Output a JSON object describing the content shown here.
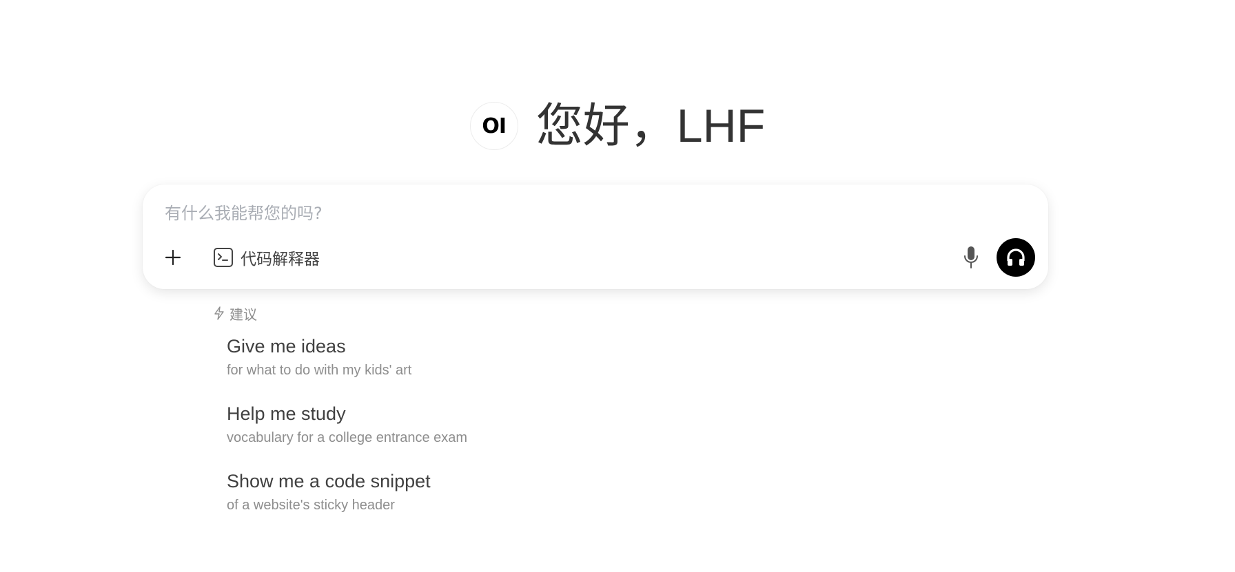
{
  "greeting": {
    "logo_text": "OI",
    "title": "您好，LHF"
  },
  "chat": {
    "placeholder": "有什么我能帮您的吗?",
    "tool_label": "代码解释器"
  },
  "icons": {
    "add": "plus-icon",
    "tool": "terminal-icon",
    "mic": "microphone-icon",
    "voice": "headphones-icon",
    "suggestions": "bolt-icon"
  },
  "suggestions": {
    "title": "建议",
    "items": [
      {
        "title": "Give me ideas",
        "subtitle": "for what to do with my kids' art"
      },
      {
        "title": "Help me study",
        "subtitle": "vocabulary for a college entrance exam"
      },
      {
        "title": "Show me a code snippet",
        "subtitle": "of a website's sticky header"
      }
    ]
  },
  "colors": {
    "voice_button_bg": "#000000",
    "placeholder": "#a9adb4",
    "muted_text": "#8e8e8e"
  }
}
